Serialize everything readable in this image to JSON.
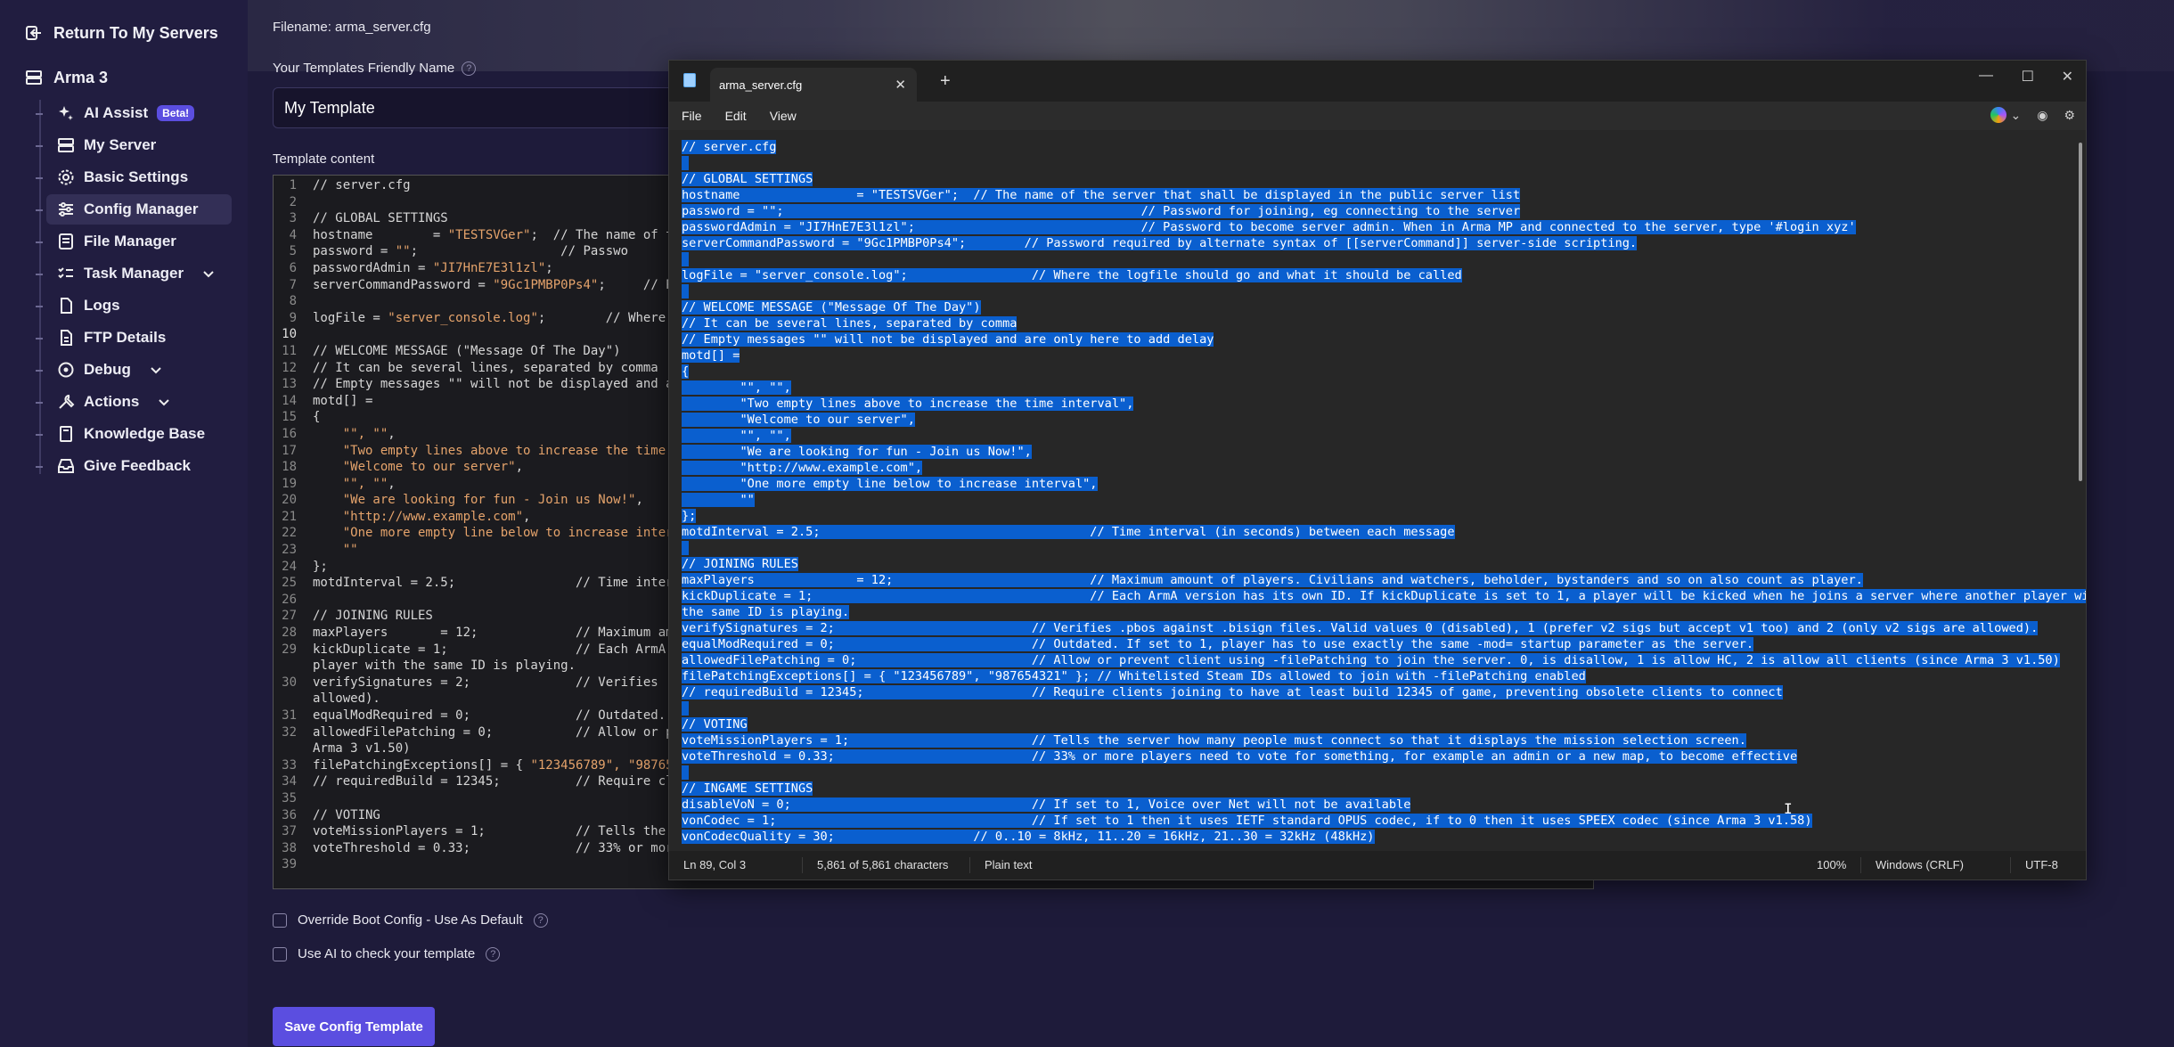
{
  "sidebar": {
    "return_label": "Return To My Servers",
    "game_label": "Arma 3",
    "items": [
      {
        "label": "AI Assist",
        "icon": "sparkles-icon",
        "badge": "Beta!"
      },
      {
        "label": "My Server",
        "icon": "server-icon"
      },
      {
        "label": "Basic Settings",
        "icon": "gear-icon"
      },
      {
        "label": "Config Manager",
        "icon": "sliders-icon",
        "active": true
      },
      {
        "label": "File Manager",
        "icon": "folder-icon"
      },
      {
        "label": "Task Manager",
        "icon": "task-list-icon",
        "expandable": true
      },
      {
        "label": "Logs",
        "icon": "document-icon"
      },
      {
        "label": "FTP Details",
        "icon": "ftp-icon"
      },
      {
        "label": "Debug",
        "icon": "bug-icon",
        "expandable": true
      },
      {
        "label": "Actions",
        "icon": "tools-icon",
        "expandable": true
      },
      {
        "label": "Knowledge Base",
        "icon": "book-icon"
      },
      {
        "label": "Give Feedback",
        "icon": "inbox-icon"
      }
    ]
  },
  "form": {
    "filename_label": "Filename: arma_server.cfg",
    "friendly_name_label": "Your Templates Friendly Name",
    "friendly_name_value": "My Template",
    "template_content_label": "Template content",
    "override_label": "Override Boot Config - Use As Default",
    "use_ai_label": "Use AI to check your template",
    "save_button": "Save Config Template"
  },
  "editor_lines": [
    {
      "n": "1",
      "t": "// server.cfg"
    },
    {
      "n": "2",
      "t": ""
    },
    {
      "n": "3",
      "t": "// GLOBAL SETTINGS"
    },
    {
      "n": "4",
      "t": "hostname        = ",
      "s": "\"TESTSVGer\"",
      "r": ";  // The name of th"
    },
    {
      "n": "5",
      "t": "password = ",
      "s": "\"\"",
      "r": ";                   // Passwo"
    },
    {
      "n": "6",
      "t": "passwordAdmin = ",
      "s": "\"JI7HnE7E3l1zl\"",
      "r": ";                  //"
    },
    {
      "n": "7",
      "t": "serverCommandPassword = ",
      "s": "\"9Gc1PMBP0Ps4\"",
      "r": ";     // Pa"
    },
    {
      "n": "8",
      "t": ""
    },
    {
      "n": "9",
      "t": "logFile = ",
      "s": "\"server_console.log\"",
      "r": ";        // Where"
    },
    {
      "n": "10",
      "t": "",
      "cur": true
    },
    {
      "n": "11",
      "t": "// WELCOME MESSAGE (\"Message Of The Day\")"
    },
    {
      "n": "12",
      "t": "// It can be several lines, separated by comma"
    },
    {
      "n": "13",
      "t": "// Empty messages \"\" will not be displayed and ar"
    },
    {
      "n": "14",
      "t": "motd[] ="
    },
    {
      "n": "15",
      "t": "{"
    },
    {
      "n": "16",
      "t": "    ",
      "s": "\"\", \"\"",
      "r": ","
    },
    {
      "n": "17",
      "t": "    ",
      "s": "\"Two empty lines above to increase the time i"
    },
    {
      "n": "18",
      "t": "    ",
      "s": "\"Welcome to our server\"",
      "r": ","
    },
    {
      "n": "19",
      "t": "    ",
      "s": "\"\", \"\"",
      "r": ","
    },
    {
      "n": "20",
      "t": "    ",
      "s": "\"We are looking for fun - Join us Now!\"",
      "r": ","
    },
    {
      "n": "21",
      "t": "    ",
      "s": "\"http://www.example.com\"",
      "r": ","
    },
    {
      "n": "22",
      "t": "    ",
      "s": "\"One more empty line below to increase interv"
    },
    {
      "n": "23",
      "t": "    ",
      "s": "\"\""
    },
    {
      "n": "24",
      "t": "};"
    },
    {
      "n": "25",
      "t": "motdInterval = 2.5;                // Time inter"
    },
    {
      "n": "26",
      "t": ""
    },
    {
      "n": "27",
      "t": "// JOINING RULES"
    },
    {
      "n": "28",
      "t": "maxPlayers       = 12;             // Maximum am"
    },
    {
      "n": "29",
      "t": "kickDuplicate = 1;                 // Each ArmA "
    },
    {
      "n": "",
      "t": "player with the same ID is playing."
    },
    {
      "n": "30",
      "t": "verifySignatures = 2;              // Verifies ."
    },
    {
      "n": "",
      "t": "allowed)."
    },
    {
      "n": "31",
      "t": "equalModRequired = 0;              // Outdated. "
    },
    {
      "n": "32",
      "t": "allowedFilePatching = 0;           // Allow or p"
    },
    {
      "n": "",
      "t": "Arma 3 v1.50)"
    },
    {
      "n": "33",
      "t": "filePatchingExceptions[] = { ",
      "s": "\"123456789\", \"987654"
    },
    {
      "n": "34",
      "t": "// requiredBuild = 12345;          // Require cl"
    },
    {
      "n": "35",
      "t": ""
    },
    {
      "n": "36",
      "t": "// VOTING"
    },
    {
      "n": "37",
      "t": "voteMissionPlayers = 1;            // Tells the "
    },
    {
      "n": "38",
      "t": "voteThreshold = 0.33;              // 33% or mor"
    },
    {
      "n": "39",
      "t": ""
    }
  ],
  "notepad": {
    "tab_title": "arma_server.cfg",
    "menu": [
      "File",
      "Edit",
      "View"
    ],
    "status": {
      "position": "Ln 89, Col 3",
      "characters": "5,861 of 5,861 characters",
      "format": "Plain text",
      "zoom": "100%",
      "line_ending": "Windows (CRLF)",
      "encoding": "UTF-8"
    },
    "lines": [
      "// server.cfg",
      "",
      "// GLOBAL SETTINGS",
      "hostname                = \"TESTSVGer\";  // The name of the server that shall be displayed in the public server list",
      "password = \"\";                                                 // Password for joining, eg connecting to the server",
      "passwordAdmin = \"JI7HnE7E3l1zl\";                               // Password to become server admin. When in Arma MP and connected to the server, type '#login xyz'",
      "serverCommandPassword = \"9Gc1PMBP0Ps4\";        // Password required by alternate syntax of [[serverCommand]] server-side scripting.",
      "",
      "logFile = \"server_console.log\";                 // Where the logfile should go and what it should be called",
      "",
      "// WELCOME MESSAGE (\"Message Of The Day\")",
      "// It can be several lines, separated by comma",
      "// Empty messages \"\" will not be displayed and are only here to add delay",
      "motd[] =",
      "{",
      "        \"\", \"\",",
      "        \"Two empty lines above to increase the time interval\",",
      "        \"Welcome to our server\",",
      "        \"\", \"\",",
      "        \"We are looking for fun - Join us Now!\",",
      "        \"http://www.example.com\",",
      "        \"One more empty line below to increase interval\",",
      "        \"\"",
      "};",
      "motdInterval = 2.5;                                     // Time interval (in seconds) between each message",
      "",
      "// JOINING RULES",
      "maxPlayers              = 12;                           // Maximum amount of players. Civilians and watchers, beholder, bystanders and so on also count as player.",
      "kickDuplicate = 1;                                      // Each ArmA version has its own ID. If kickDuplicate is set to 1, a player will be kicked when he joins a server where another player with",
      "the same ID is playing.",
      "verifySignatures = 2;                           // Verifies .pbos against .bisign files. Valid values 0 (disabled), 1 (prefer v2 sigs but accept v1 too) and 2 (only v2 sigs are allowed).",
      "equalModRequired = 0;                           // Outdated. If set to 1, player has to use exactly the same -mod= startup parameter as the server.",
      "allowedFilePatching = 0;                        // Allow or prevent client using -filePatching to join the server. 0, is disallow, 1 is allow HC, 2 is allow all clients (since Arma 3 v1.50)",
      "filePatchingExceptions[] = { \"123456789\", \"987654321\" }; // Whitelisted Steam IDs allowed to join with -filePatching enabled",
      "// requiredBuild = 12345;                       // Require clients joining to have at least build 12345 of game, preventing obsolete clients to connect",
      "",
      "// VOTING",
      "voteMissionPlayers = 1;                         // Tells the server how many people must connect so that it displays the mission selection screen.",
      "voteThreshold = 0.33;                           // 33% or more players need to vote for something, for example an admin or a new map, to become effective",
      "",
      "// INGAME SETTINGS",
      "disableVoN = 0;                                 // If set to 1, Voice over Net will not be available",
      "vonCodec = 1;                                   // If set to 1 then it uses IETF standard OPUS codec, if to 0 then it uses SPEEX codec (since Arma 3 v1.58)",
      "vonCodecQuality = 30;                   // 0..10 = 8kHz, 11..20 = 16kHz, 21..30 = 32kHz (48kHz)"
    ]
  }
}
